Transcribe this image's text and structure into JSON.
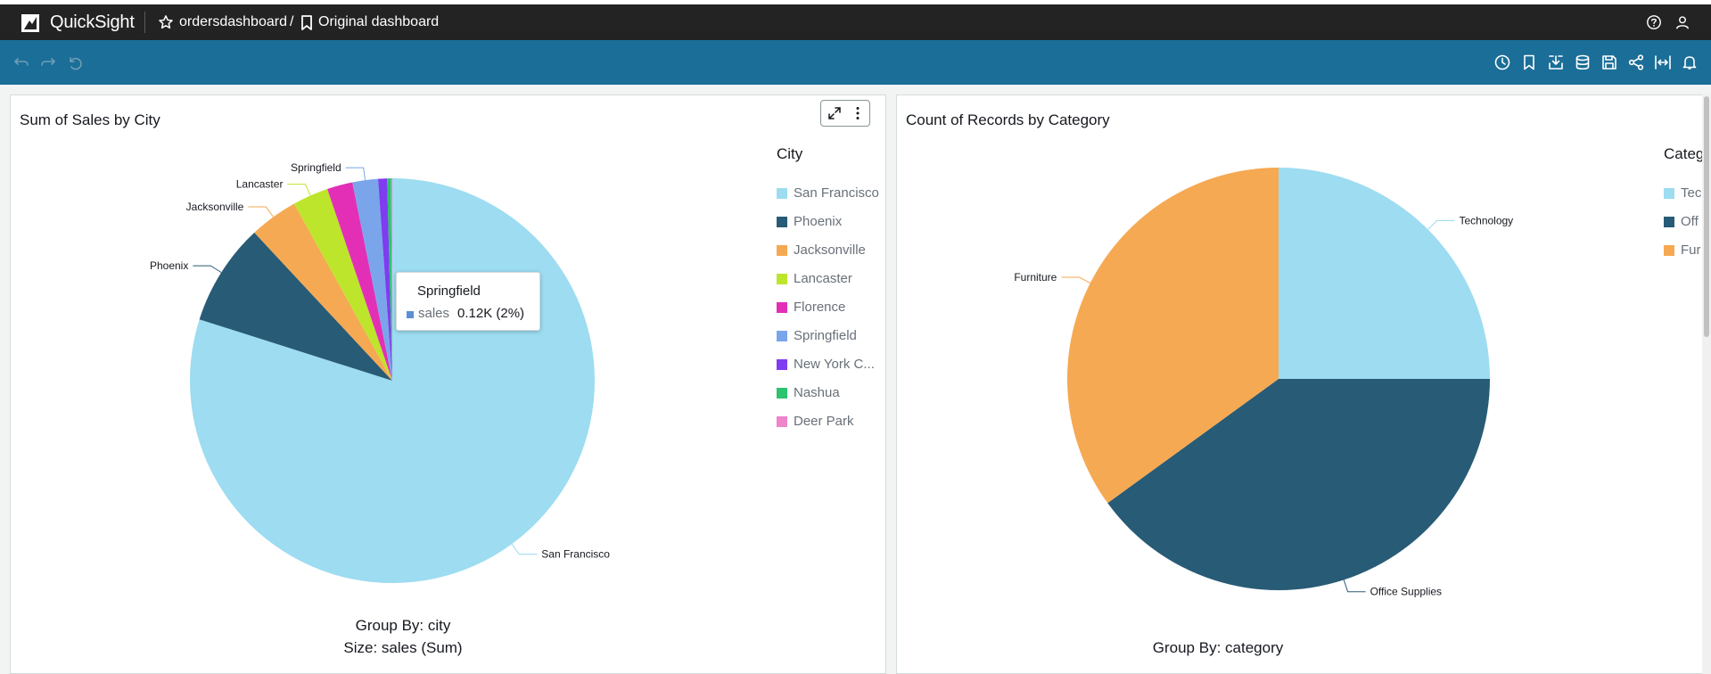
{
  "app": {
    "brand": "QuickSight"
  },
  "breadcrumb": {
    "dashboard": "ordersdashboard",
    "sheet": "Original dashboard",
    "separator": "/"
  },
  "toolbar": {
    "left": [
      "undo-icon",
      "redo-icon",
      "reset-icon"
    ],
    "right": [
      "history-icon",
      "bookmark-icon",
      "download-icon",
      "dataset-icon",
      "save-icon",
      "share-icon",
      "fit-width-icon",
      "alert-icon"
    ]
  },
  "colors": {
    "appbar": "#232323",
    "toolbar": "#1b6e97",
    "canvas": "#f2f3f3",
    "series": [
      "#9ddcf1",
      "#285b75",
      "#f5a953",
      "#bde52c",
      "#e32fb6",
      "#7aa5ea",
      "#7f3cf0",
      "#2cc46e",
      "#ed85c8"
    ]
  },
  "visual1": {
    "title": "Sum of Sales by City",
    "legend_title": "City",
    "legend": [
      "San Francisco",
      "Phoenix",
      "Jacksonville",
      "Lancaster",
      "Florence",
      "Springfield",
      "New York C...",
      "Nashua",
      "Deer Park"
    ],
    "footer": [
      "Group By: city",
      "Size: sales (Sum)"
    ],
    "tooltip": {
      "title": "Springfield",
      "measure": "sales",
      "value": "0.12K (2%)"
    }
  },
  "visual2": {
    "title": "Count of Records by Category",
    "legend_title": "Categ",
    "legend": [
      "Tec",
      "Off",
      "Fur"
    ],
    "footer": [
      "Group By: category"
    ]
  },
  "chart_data": [
    {
      "type": "pie",
      "title": "Sum of Sales by City",
      "categories": [
        "San Francisco",
        "Phoenix",
        "Jacksonville",
        "Lancaster",
        "Florence",
        "Springfield",
        "New York C...",
        "Nashua",
        "Deer Park"
      ],
      "values": [
        78.3,
        8.0,
        3.8,
        2.8,
        2.0,
        2.0,
        0.7,
        0.3,
        0.1
      ],
      "unit": "percent of sales (estimated)",
      "slice_labels": [
        "San Francisco",
        "Phoenix",
        "Jacksonville",
        "Lancaster",
        "",
        "Springfield",
        "",
        "",
        ""
      ]
    },
    {
      "type": "pie",
      "title": "Count of Records by Category",
      "categories": [
        "Technology",
        "Office Supplies",
        "Furniture"
      ],
      "values": [
        25,
        40,
        35
      ],
      "unit": "percent of records (estimated)",
      "slice_labels": [
        "Technology",
        "Office Supplies",
        "Furniture"
      ]
    }
  ]
}
